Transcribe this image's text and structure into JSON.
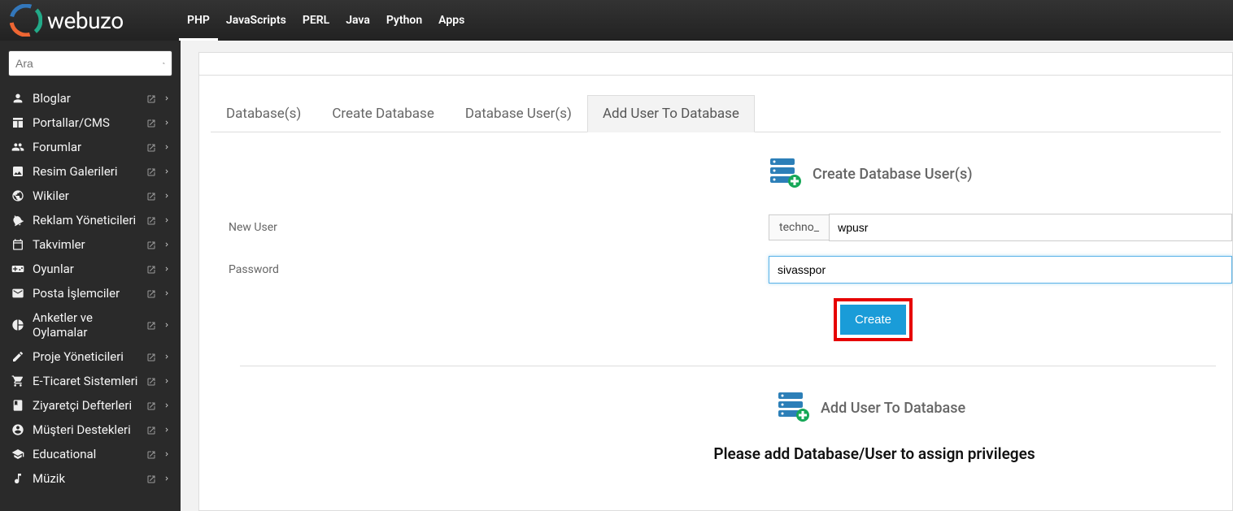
{
  "brand": "webuzo",
  "topnav": [
    "PHP",
    "JavaScripts",
    "PERL",
    "Java",
    "Python",
    "Apps"
  ],
  "topnav_active": 0,
  "search_placeholder": "Ara",
  "sidebar": [
    {
      "icon": "user",
      "label": "Bloglar"
    },
    {
      "icon": "layout",
      "label": "Portallar/CMS"
    },
    {
      "icon": "users",
      "label": "Forumlar"
    },
    {
      "icon": "image",
      "label": "Resim Galerileri"
    },
    {
      "icon": "globe",
      "label": "Wikiler"
    },
    {
      "icon": "bullhorn",
      "label": "Reklam Yöneticileri"
    },
    {
      "icon": "calendar",
      "label": "Takvimler"
    },
    {
      "icon": "gamepad",
      "label": "Oyunlar"
    },
    {
      "icon": "envelope",
      "label": "Posta İşlemciler"
    },
    {
      "icon": "piechart",
      "label": "Anketler ve Oylamalar"
    },
    {
      "icon": "edit",
      "label": "Proje Yöneticileri"
    },
    {
      "icon": "cart",
      "label": "E-Ticaret Sistemleri"
    },
    {
      "icon": "book",
      "label": "Ziyaretçi Defterleri"
    },
    {
      "icon": "lifering",
      "label": "Müşteri Destekleri"
    },
    {
      "icon": "gradcap",
      "label": "Educational"
    },
    {
      "icon": "music",
      "label": "Müzik"
    }
  ],
  "tabs": [
    "Database(s)",
    "Create Database",
    "Database User(s)",
    "Add User To Database"
  ],
  "tabs_active": 3,
  "section1_title": "Create Database User(s)",
  "form": {
    "new_user_label": "New User",
    "prefix": "techno_",
    "username_value": "wpusr",
    "password_label": "Password",
    "password_value": "sivasspor"
  },
  "create_button": "Create",
  "section2_title": "Add User To Database",
  "bottom_message": "Please add Database/User to assign privileges"
}
